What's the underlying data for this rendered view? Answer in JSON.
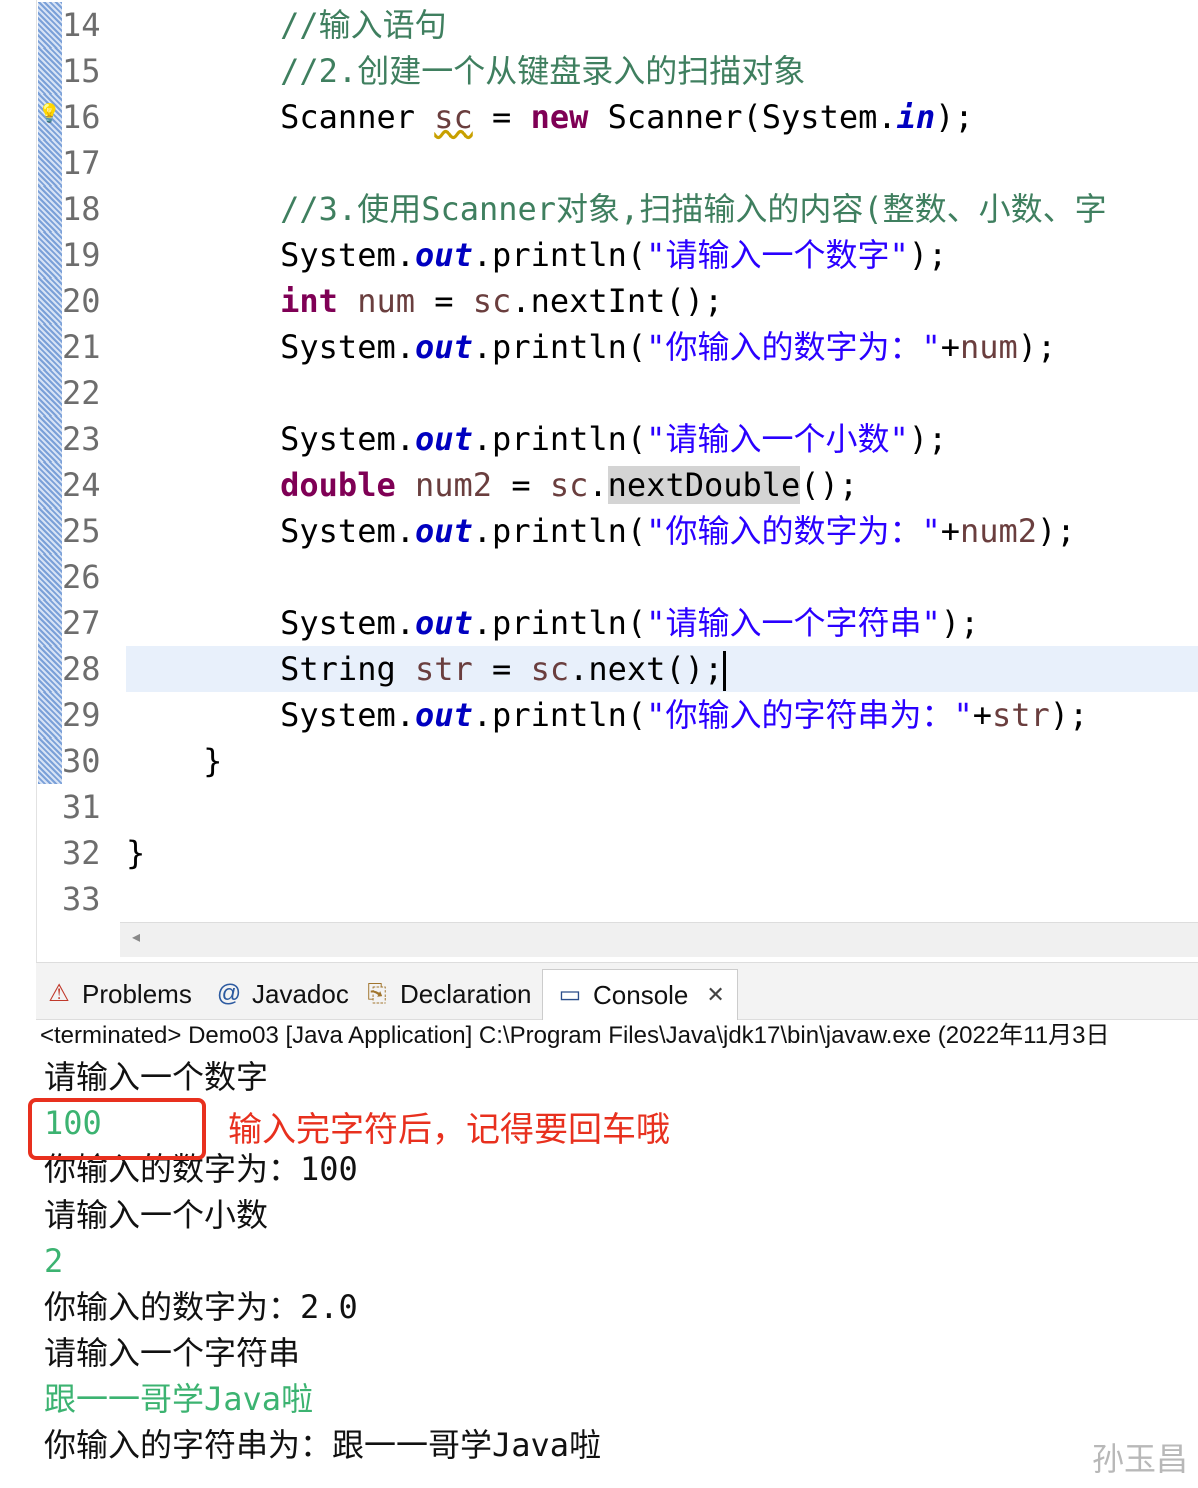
{
  "editor": {
    "lines": [
      {
        "num": "14",
        "segments": [
          {
            "t": "//输入语句",
            "c": "com"
          }
        ],
        "indent": "        "
      },
      {
        "num": "15",
        "segments": [
          {
            "t": "//2.创建一个从键盘录入的扫描对象",
            "c": "com"
          }
        ],
        "indent": "        "
      },
      {
        "num": "16",
        "segments": [
          {
            "t": "Scanner ",
            "c": ""
          },
          {
            "t": "sc",
            "c": "var squig"
          },
          {
            "t": " = ",
            "c": ""
          },
          {
            "t": "new",
            "c": "kw"
          },
          {
            "t": " Scanner(System.",
            "c": ""
          },
          {
            "t": "in",
            "c": "fld"
          },
          {
            "t": ");",
            "c": ""
          }
        ],
        "indent": "        "
      },
      {
        "num": "17",
        "segments": [],
        "indent": ""
      },
      {
        "num": "18",
        "segments": [
          {
            "t": "//3.使用Scanner对象,扫描输入的内容(整数、小数、字",
            "c": "com"
          }
        ],
        "indent": "        "
      },
      {
        "num": "19",
        "segments": [
          {
            "t": "System.",
            "c": ""
          },
          {
            "t": "out",
            "c": "fld"
          },
          {
            "t": ".println(",
            "c": ""
          },
          {
            "t": "\"请输入一个数字\"",
            "c": "str"
          },
          {
            "t": ");",
            "c": ""
          }
        ],
        "indent": "        "
      },
      {
        "num": "20",
        "segments": [
          {
            "t": "int",
            "c": "kw"
          },
          {
            "t": " ",
            "c": ""
          },
          {
            "t": "num",
            "c": "var"
          },
          {
            "t": " = ",
            "c": ""
          },
          {
            "t": "sc",
            "c": "var"
          },
          {
            "t": ".nextInt();",
            "c": ""
          }
        ],
        "indent": "        "
      },
      {
        "num": "21",
        "segments": [
          {
            "t": "System.",
            "c": ""
          },
          {
            "t": "out",
            "c": "fld"
          },
          {
            "t": ".println(",
            "c": ""
          },
          {
            "t": "\"你输入的数字为：\"",
            "c": "str"
          },
          {
            "t": "+",
            "c": ""
          },
          {
            "t": "num",
            "c": "var"
          },
          {
            "t": ");",
            "c": ""
          }
        ],
        "indent": "        "
      },
      {
        "num": "22",
        "segments": [],
        "indent": ""
      },
      {
        "num": "23",
        "segments": [
          {
            "t": "System.",
            "c": ""
          },
          {
            "t": "out",
            "c": "fld"
          },
          {
            "t": ".println(",
            "c": ""
          },
          {
            "t": "\"请输入一个小数\"",
            "c": "str"
          },
          {
            "t": ");",
            "c": ""
          }
        ],
        "indent": "        "
      },
      {
        "num": "24",
        "segments": [
          {
            "t": "double",
            "c": "kw"
          },
          {
            "t": " ",
            "c": ""
          },
          {
            "t": "num2",
            "c": "var"
          },
          {
            "t": " = ",
            "c": ""
          },
          {
            "t": "sc",
            "c": "var"
          },
          {
            "t": ".",
            "c": ""
          },
          {
            "t": "nextDouble",
            "c": "hl"
          },
          {
            "t": "();",
            "c": ""
          }
        ],
        "indent": "        "
      },
      {
        "num": "25",
        "segments": [
          {
            "t": "System.",
            "c": ""
          },
          {
            "t": "out",
            "c": "fld"
          },
          {
            "t": ".println(",
            "c": ""
          },
          {
            "t": "\"你输入的数字为：\"",
            "c": "str"
          },
          {
            "t": "+",
            "c": ""
          },
          {
            "t": "num2",
            "c": "var"
          },
          {
            "t": ");",
            "c": ""
          }
        ],
        "indent": "        "
      },
      {
        "num": "26",
        "segments": [],
        "indent": ""
      },
      {
        "num": "27",
        "segments": [
          {
            "t": "System.",
            "c": ""
          },
          {
            "t": "out",
            "c": "fld"
          },
          {
            "t": ".println(",
            "c": ""
          },
          {
            "t": "\"请输入一个字符串\"",
            "c": "str"
          },
          {
            "t": ");",
            "c": ""
          }
        ],
        "indent": "        "
      },
      {
        "num": "28",
        "segments": [
          {
            "t": "String ",
            "c": ""
          },
          {
            "t": "str",
            "c": "var"
          },
          {
            "t": " = ",
            "c": ""
          },
          {
            "t": "sc",
            "c": "var"
          },
          {
            "t": ".next();",
            "c": ""
          }
        ],
        "indent": "        ",
        "current": true
      },
      {
        "num": "29",
        "segments": [
          {
            "t": "System.",
            "c": ""
          },
          {
            "t": "out",
            "c": "fld"
          },
          {
            "t": ".println(",
            "c": ""
          },
          {
            "t": "\"你输入的字符串为：\"",
            "c": "str"
          },
          {
            "t": "+",
            "c": ""
          },
          {
            "t": "str",
            "c": "var"
          },
          {
            "t": ");",
            "c": ""
          }
        ],
        "indent": "        "
      },
      {
        "num": "30",
        "segments": [
          {
            "t": "}",
            "c": ""
          }
        ],
        "indent": "    "
      },
      {
        "num": "31",
        "segments": [],
        "indent": ""
      },
      {
        "num": "32",
        "segments": [
          {
            "t": "}",
            "c": ""
          }
        ],
        "indent": ""
      },
      {
        "num": "33",
        "segments": [],
        "indent": ""
      }
    ]
  },
  "views": {
    "tabs": [
      {
        "label": "Problems",
        "icon": "problems-icon",
        "glyph": "⚠"
      },
      {
        "label": "Javadoc",
        "icon": "at-icon",
        "glyph": "@"
      },
      {
        "label": "Declaration",
        "icon": "declaration-icon",
        "glyph": "⎘"
      },
      {
        "label": "Console",
        "icon": "console-icon",
        "glyph": "▭",
        "active": true
      }
    ],
    "close_glyph": "✕",
    "status": "<terminated> Demo03 [Java Application] C:\\Program Files\\Java\\jdk17\\bin\\javaw.exe  (2022年11月3日"
  },
  "console": {
    "lines": [
      {
        "text": "请输入一个数字",
        "type": "sys"
      },
      {
        "text": "100",
        "type": "user"
      },
      {
        "text": "你输入的数字为：100",
        "type": "sys"
      },
      {
        "text": "请输入一个小数",
        "type": "sys"
      },
      {
        "text": "2",
        "type": "user"
      },
      {
        "text": "你输入的数字为：2.0",
        "type": "sys"
      },
      {
        "text": "请输入一个字符串",
        "type": "sys"
      },
      {
        "text": "跟一一哥学Java啦",
        "type": "user"
      },
      {
        "text": "你输入的字符串为：跟一一哥学Java啦",
        "type": "sys"
      }
    ],
    "annotation": "输入完字符后，记得要回车哦"
  },
  "watermark": "孙玉昌",
  "colors": {
    "keyword": "#7f0055",
    "comment": "#3f7f5f",
    "string": "#2a00ff",
    "field": "#0000c0",
    "user_input": "#3cb371",
    "annotation": "#e8301e"
  }
}
